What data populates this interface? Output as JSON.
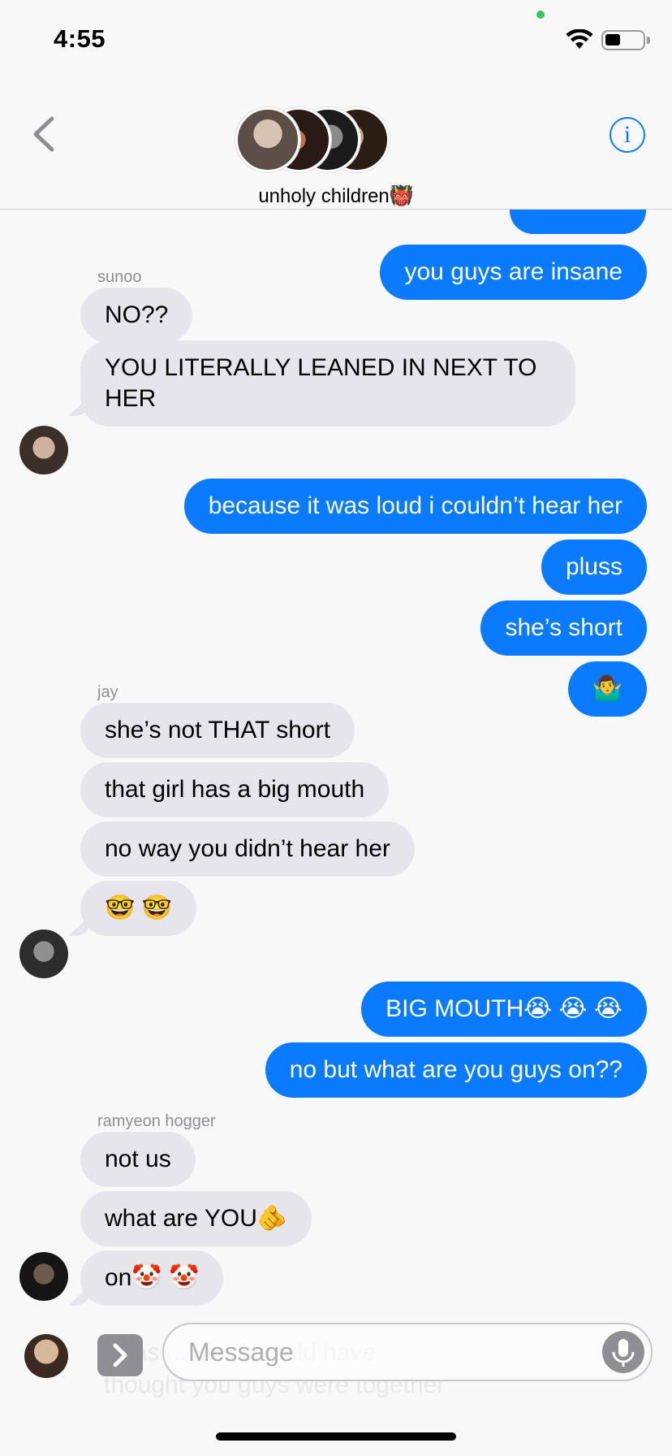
{
  "status": {
    "time": "4:55"
  },
  "header": {
    "group_name": "unholy children👹"
  },
  "messages": {
    "m0": "you guys are insane",
    "s1": "sunoo",
    "m1": "NO??",
    "m2": "YOU LITERALLY LEANED IN NEXT TO HER",
    "m3": "because it was loud i couldn’t hear her",
    "m4": "pluss",
    "m5": "she’s short",
    "m6": "🤷‍♂️",
    "s2": "jay",
    "m7": "she’s not THAT short",
    "m8": "that girl has a big mouth",
    "m9": "no way you didn’t hear her",
    "m10": "🤓 🤓",
    "m11": "BIG MOUTH😭 😭 😭",
    "m12": "no but what are you guys on??",
    "s3": "ramyeon hogger",
    "m13": "not us",
    "m14": "what are YOU🫵",
    "m15": "on🤡 🤡"
  },
  "behind_compose": {
    "ghost_line1": "i was ... ider i would have",
    "ghost_line2": "thought you guys were together"
  },
  "compose": {
    "placeholder": "Message"
  },
  "colors": {
    "outgoing": "#0a7aff",
    "incoming": "#e6e5eb",
    "accent": "#0a7aff"
  }
}
